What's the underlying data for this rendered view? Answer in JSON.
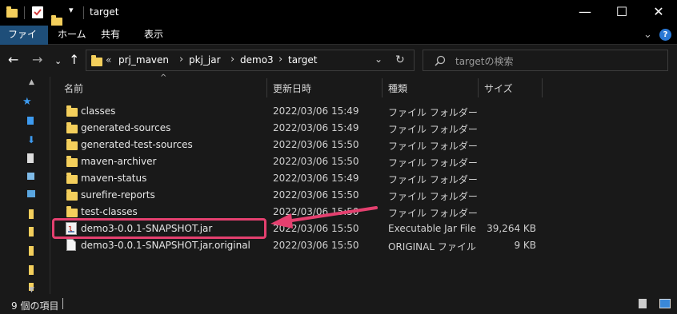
{
  "window": {
    "title": "target"
  },
  "ribbon": {
    "tabs": [
      "ファイル",
      "ホーム",
      "共有",
      "表示"
    ]
  },
  "address": {
    "overflow": "«",
    "crumbs": [
      "prj_maven",
      "pkj_jar",
      "demo3",
      "target"
    ]
  },
  "search": {
    "placeholder": "targetの検索"
  },
  "columns": {
    "name": "名前",
    "date": "更新日時",
    "type": "種類",
    "size": "サイズ"
  },
  "files": [
    {
      "name": "classes",
      "date": "2022/03/06 15:49",
      "type": "ファイル フォルダー",
      "size": "",
      "icon": "folder-icon"
    },
    {
      "name": "generated-sources",
      "date": "2022/03/06 15:49",
      "type": "ファイル フォルダー",
      "size": "",
      "icon": "folder-icon"
    },
    {
      "name": "generated-test-sources",
      "date": "2022/03/06 15:50",
      "type": "ファイル フォルダー",
      "size": "",
      "icon": "folder-icon"
    },
    {
      "name": "maven-archiver",
      "date": "2022/03/06 15:50",
      "type": "ファイル フォルダー",
      "size": "",
      "icon": "folder-icon"
    },
    {
      "name": "maven-status",
      "date": "2022/03/06 15:49",
      "type": "ファイル フォルダー",
      "size": "",
      "icon": "folder-icon"
    },
    {
      "name": "surefire-reports",
      "date": "2022/03/06 15:50",
      "type": "ファイル フォルダー",
      "size": "",
      "icon": "folder-icon"
    },
    {
      "name": "test-classes",
      "date": "2022/03/06 15:50",
      "type": "ファイル フォルダー",
      "size": "",
      "icon": "folder-icon"
    },
    {
      "name": "demo3-0.0.1-SNAPSHOT.jar",
      "date": "2022/03/06 15:50",
      "type": "Executable Jar File",
      "size": "39,264 KB",
      "icon": "jar-file-icon"
    },
    {
      "name": "demo3-0.0.1-SNAPSHOT.jar.original",
      "date": "2022/03/06 15:50",
      "type": "ORIGINAL ファイル",
      "size": "9 KB",
      "icon": "document-icon"
    }
  ],
  "status": {
    "count_text": "9 個の項目"
  },
  "colors": {
    "highlight": "#e4406f",
    "folder": "#f4cf5c",
    "accent": "#1e4e79"
  }
}
